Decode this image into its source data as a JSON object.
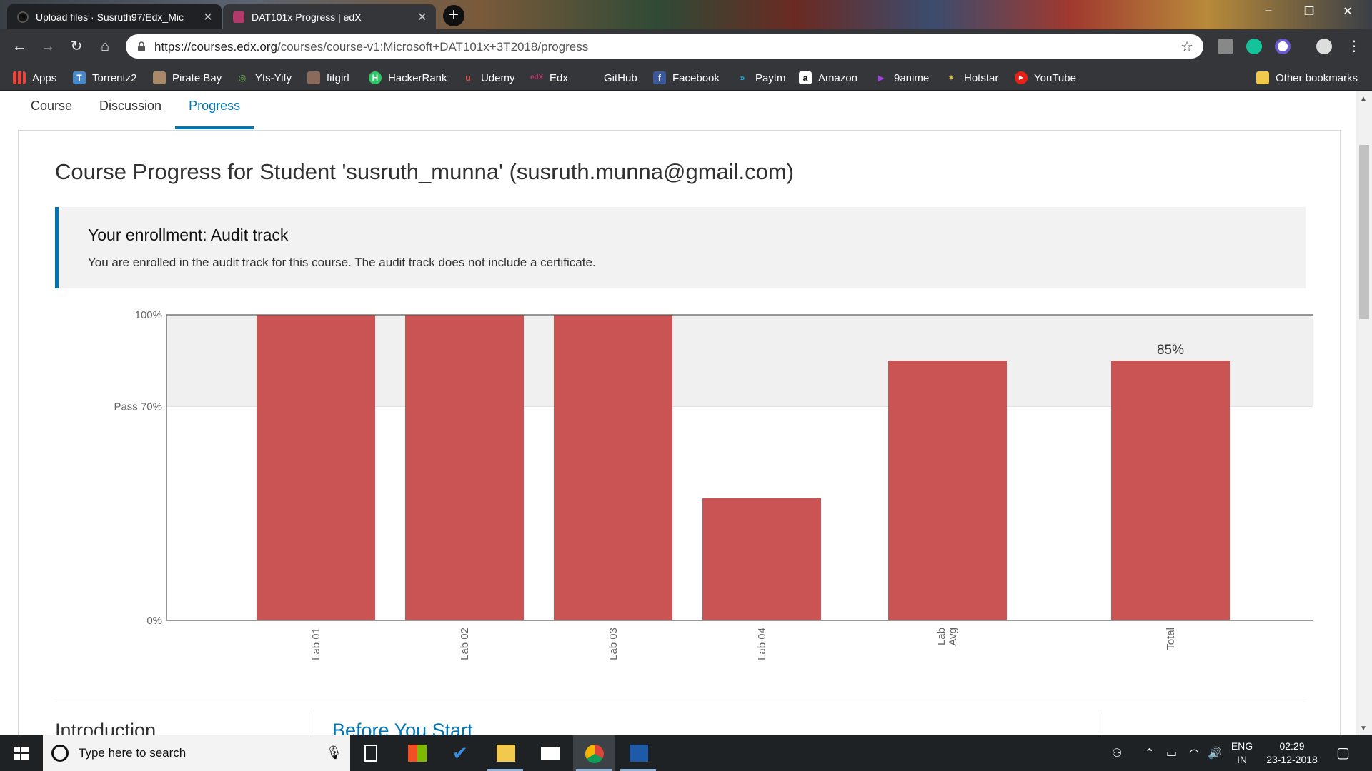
{
  "browser": {
    "tabs": [
      {
        "title": "Upload files · Susruth97/Edx_Mic",
        "active": false
      },
      {
        "title": "DAT101x Progress | edX",
        "active": true
      }
    ],
    "new_tab": "+",
    "window_controls": [
      "–",
      "❐",
      "✕"
    ],
    "url_host": "https://courses.edx.org",
    "url_path": "/courses/course-v1:Microsoft+DAT101x+3T2018/progress",
    "bookmarks": [
      "Apps",
      "Torrentz2",
      "Pirate Bay",
      "Yts-Yify",
      "fitgirl",
      "HackerRank",
      "Udemy",
      "Edx",
      "GitHub",
      "Facebook",
      "Paytm",
      "Amazon",
      "9anime",
      "Hotstar",
      "YouTube"
    ],
    "other_bookmarks": "Other bookmarks"
  },
  "course_nav": [
    "Course",
    "Discussion",
    "Progress"
  ],
  "page": {
    "title": "Course Progress for Student 'susruth_munna' (susruth.munna@gmail.com)",
    "enrollment_heading": "Your enrollment: Audit track",
    "enrollment_text": "You are enrolled in the audit track for this course. The audit track does not include a certificate.",
    "section_title": "Introduction",
    "subsection_link": "Before You Start"
  },
  "chart_data": {
    "type": "bar",
    "categories": [
      "Lab 01",
      "Lab 02",
      "Lab 03",
      "Lab 04",
      "Lab Avg",
      "Total"
    ],
    "values": [
      100,
      100,
      100,
      40,
      85,
      85
    ],
    "data_labels": {
      "Total": "85%"
    },
    "y_ticks": [
      {
        "value": 0,
        "label": "0%"
      },
      {
        "value": 70,
        "label": "Pass 70%"
      },
      {
        "value": 100,
        "label": "100%"
      }
    ],
    "ylim": [
      0,
      100
    ],
    "pass_threshold": 70,
    "bar_color": "#c84c4c",
    "pass_band_color": "#f0f0f0"
  },
  "taskbar": {
    "search_placeholder": "Type here to search",
    "language": "ENG",
    "region": "IN",
    "time": "02:29",
    "date": "23-12-2018"
  },
  "colors": {
    "accent": "#0075b4",
    "chrome": "#35363a",
    "taskbar": "#1e2224"
  }
}
